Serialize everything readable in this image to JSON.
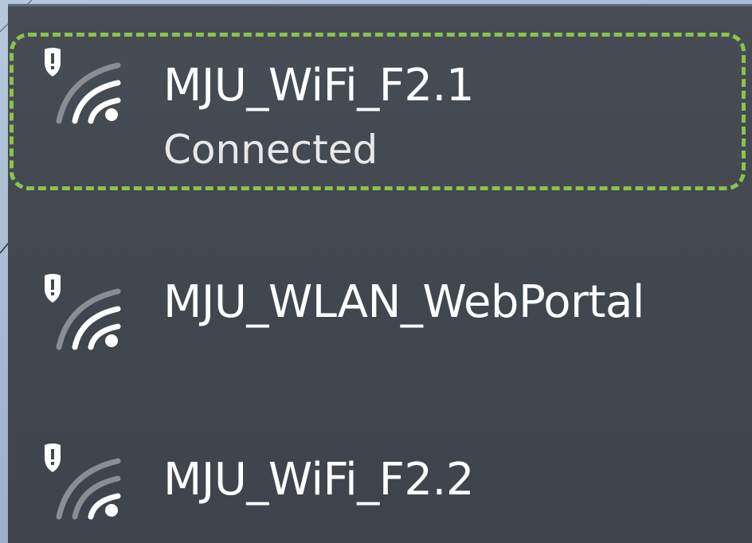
{
  "networks": [
    {
      "name": "MJU_WiFi_F2.1",
      "status": "Connected",
      "secured": true,
      "focused": true
    },
    {
      "name": "MJU_WLAN_WebPortal",
      "secured": true,
      "focused": false
    },
    {
      "name": "MJU_WiFi_F2.2",
      "secured": true,
      "focused": false
    }
  ],
  "colors": {
    "panel_bg": "#43484f",
    "text": "#ffffff",
    "focus_ring": "#8bc34a",
    "signal_active": "#ffffff",
    "signal_inactive": "#8a8d92"
  },
  "icons": {
    "network": "wifi-secured-icon",
    "shield": "shield-warning-icon"
  }
}
